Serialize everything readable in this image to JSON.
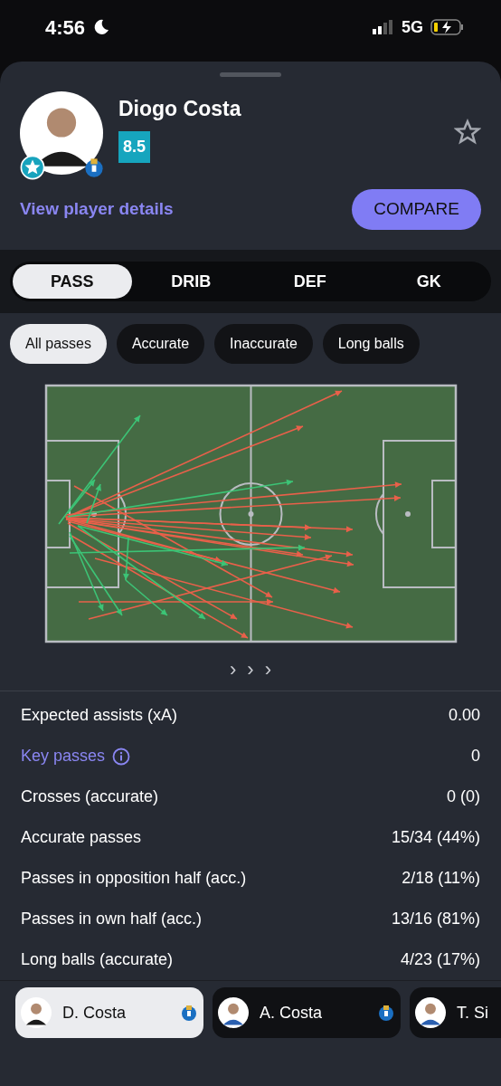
{
  "status_bar": {
    "time": "4:56",
    "network": "5G"
  },
  "player": {
    "name": "Diogo Costa",
    "rating": "8.5",
    "link": "View player details",
    "compare": "COMPARE",
    "favorite": false
  },
  "tabs": [
    {
      "label": "PASS",
      "selected": true
    },
    {
      "label": "DRIB",
      "selected": false
    },
    {
      "label": "DEF",
      "selected": false
    },
    {
      "label": "GK",
      "selected": false
    }
  ],
  "filters": [
    {
      "label": "All passes",
      "selected": true
    },
    {
      "label": "Accurate",
      "selected": false
    },
    {
      "label": "Inaccurate",
      "selected": false
    },
    {
      "label": "Long balls",
      "selected": false
    }
  ],
  "pager": [
    "›",
    "›",
    "›"
  ],
  "stats": [
    {
      "kind": "plain",
      "label": "Expected assists (xA)",
      "value": "0.00"
    },
    {
      "kind": "link",
      "label": "Key passes",
      "value": "0"
    },
    {
      "kind": "plain",
      "label": "Crosses (accurate)",
      "value": "0 (0)"
    },
    {
      "kind": "plain",
      "label": "Accurate passes",
      "value": "15/34 (44%)"
    },
    {
      "kind": "plain",
      "label": "Passes in opposition half (acc.)",
      "value": "2/18 (11%)"
    },
    {
      "kind": "plain",
      "label": "Passes in own half (acc.)",
      "value": "13/16 (81%)"
    },
    {
      "kind": "plain",
      "label": "Long balls (accurate)",
      "value": "4/23 (17%)"
    }
  ],
  "players": [
    {
      "name": "D. Costa",
      "selected": true
    },
    {
      "name": "A. Costa",
      "selected": false
    },
    {
      "name": "T. Si",
      "selected": false
    }
  ]
}
